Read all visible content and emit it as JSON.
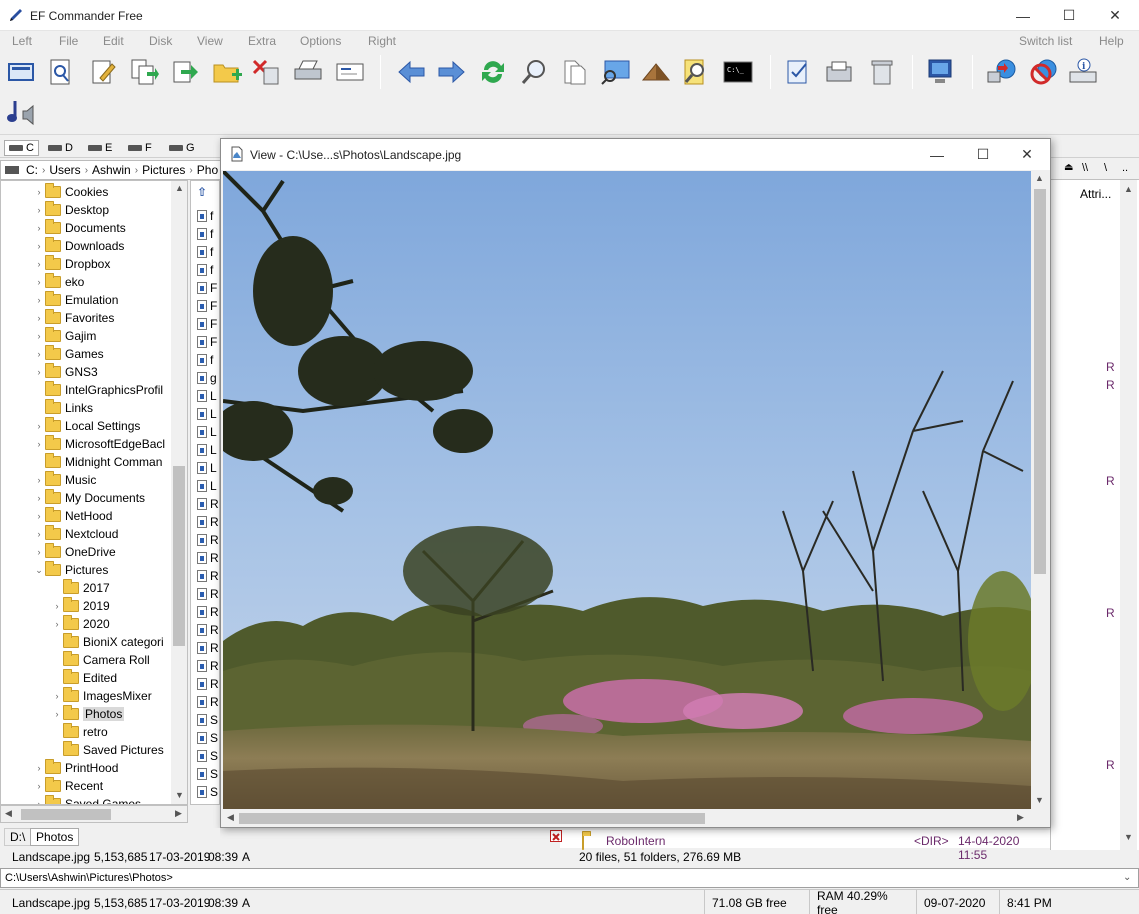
{
  "app": {
    "title": "EF Commander Free"
  },
  "window_controls": {
    "minimize": "—",
    "maximize": "☐",
    "close": "✕"
  },
  "menu": {
    "left": "Left",
    "file": "File",
    "edit": "Edit",
    "disk": "Disk",
    "view": "View",
    "extra": "Extra",
    "options": "Options",
    "right": "Right",
    "switch_list": "Switch list",
    "help": "Help"
  },
  "drives": [
    "C",
    "D",
    "E",
    "F",
    "G"
  ],
  "left_path": {
    "segments": [
      "C:",
      "Users",
      "Ashwin",
      "Pictures",
      "Pho"
    ]
  },
  "tree": {
    "items": [
      {
        "label": "Cookies",
        "depth": 0,
        "chev": "›"
      },
      {
        "label": "Desktop",
        "depth": 0,
        "chev": "›"
      },
      {
        "label": "Documents",
        "depth": 0,
        "chev": "›"
      },
      {
        "label": "Downloads",
        "depth": 0,
        "chev": "›"
      },
      {
        "label": "Dropbox",
        "depth": 0,
        "chev": "›"
      },
      {
        "label": "eko",
        "depth": 0,
        "chev": "›"
      },
      {
        "label": "Emulation",
        "depth": 0,
        "chev": "›"
      },
      {
        "label": "Favorites",
        "depth": 0,
        "chev": "›"
      },
      {
        "label": "Gajim",
        "depth": 0,
        "chev": "›"
      },
      {
        "label": "Games",
        "depth": 0,
        "chev": "›"
      },
      {
        "label": "GNS3",
        "depth": 0,
        "chev": "›"
      },
      {
        "label": "IntelGraphicsProfil",
        "depth": 0,
        "chev": ""
      },
      {
        "label": "Links",
        "depth": 0,
        "chev": ""
      },
      {
        "label": "Local Settings",
        "depth": 0,
        "chev": "›"
      },
      {
        "label": "MicrosoftEdgeBacl",
        "depth": 0,
        "chev": "›"
      },
      {
        "label": "Midnight Comman",
        "depth": 0,
        "chev": ""
      },
      {
        "label": "Music",
        "depth": 0,
        "chev": "›"
      },
      {
        "label": "My Documents",
        "depth": 0,
        "chev": "›"
      },
      {
        "label": "NetHood",
        "depth": 0,
        "chev": "›"
      },
      {
        "label": "Nextcloud",
        "depth": 0,
        "chev": "›"
      },
      {
        "label": "OneDrive",
        "depth": 0,
        "chev": "›"
      },
      {
        "label": "Pictures",
        "depth": 0,
        "chev": "⌄"
      },
      {
        "label": "2017",
        "depth": 1,
        "chev": ""
      },
      {
        "label": "2019",
        "depth": 1,
        "chev": "›"
      },
      {
        "label": "2020",
        "depth": 1,
        "chev": "›"
      },
      {
        "label": "BioniX categori",
        "depth": 1,
        "chev": ""
      },
      {
        "label": "Camera Roll",
        "depth": 1,
        "chev": ""
      },
      {
        "label": "Edited",
        "depth": 1,
        "chev": ""
      },
      {
        "label": "ImagesMixer",
        "depth": 1,
        "chev": "›"
      },
      {
        "label": "Photos",
        "depth": 1,
        "chev": "›",
        "selected": true
      },
      {
        "label": "retro",
        "depth": 1,
        "chev": ""
      },
      {
        "label": "Saved Pictures",
        "depth": 1,
        "chev": ""
      },
      {
        "label": "PrintHood",
        "depth": 0,
        "chev": "›"
      },
      {
        "label": "Recent",
        "depth": 0,
        "chev": "›"
      },
      {
        "label": "Saved Games",
        "depth": 0,
        "chev": "›"
      }
    ]
  },
  "mid_files": [
    "f",
    "f",
    "f",
    "f",
    "F",
    "F",
    "F",
    "F",
    "f",
    "g",
    "L",
    "L",
    "L",
    "L",
    "L",
    "L",
    "R",
    "R",
    "R",
    "R",
    "R",
    "R",
    "R",
    "R",
    "R",
    "R",
    "R",
    "R",
    "S",
    "S",
    "S",
    "S",
    "S"
  ],
  "viewer": {
    "title": "View - C:\\Use...s\\Photos\\Landscape.jpg"
  },
  "right_panel": {
    "header": "Attri...",
    "attr_marks": [
      "R",
      "R",
      "R",
      "R",
      "R"
    ],
    "partial_row": {
      "name": "RoboIntern",
      "type": "<DIR>",
      "date": "14-04-2020 11:55"
    }
  },
  "tabs": {
    "drive_tab": "D:\\",
    "photos_tab": "Photos"
  },
  "status": {
    "left_file": "Landscape.jpg",
    "left_size": "5,153,685",
    "left_date": "17-03-2019",
    "left_time": "08:39",
    "left_attr": "A",
    "right_summary": "20 files, 51 folders, 276.69 MB"
  },
  "cmdline": {
    "path": "C:\\Users\\Ashwin\\Pictures\\Photos>"
  },
  "bottom": {
    "file": "Landscape.jpg",
    "size": "5,153,685",
    "date": "17-03-2019",
    "time": "08:39",
    "attr": "A",
    "free": "71.08 GB free",
    "ram": "RAM 40.29% free",
    "today": "09-07-2020",
    "clock": "8:41 PM"
  }
}
